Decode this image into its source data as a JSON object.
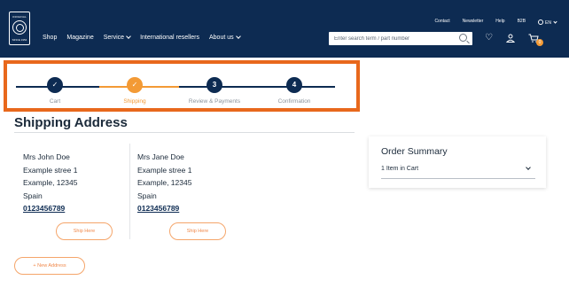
{
  "header": {
    "logo": {
      "brand_text": "ORIGINAL",
      "tag_text": "SINCE 1954"
    },
    "main_nav": [
      {
        "label": "Shop",
        "has_dropdown": false
      },
      {
        "label": "Magazine",
        "has_dropdown": false
      },
      {
        "label": "Service",
        "has_dropdown": true
      },
      {
        "label": "International resellers",
        "has_dropdown": false
      },
      {
        "label": "About us",
        "has_dropdown": true
      }
    ],
    "top_nav": {
      "contact": "Contact",
      "newsletter": "Newsletter",
      "help": "Help",
      "b2b": "B2B",
      "language": "EN"
    },
    "search": {
      "placeholder": "Enter search term / part number",
      "value": ""
    },
    "cart_count": "0"
  },
  "stepper": {
    "steps": [
      {
        "number": "1",
        "label": "Cart",
        "state": "done"
      },
      {
        "number": "2",
        "label": "Shipping",
        "state": "current"
      },
      {
        "number": "3",
        "label": "Review & Payments",
        "state": "todo"
      },
      {
        "number": "4",
        "label": "Confirmation",
        "state": "todo"
      }
    ],
    "colors": {
      "done": "#0d2b52",
      "current": "#f39a35",
      "todo": "#0d2b52",
      "label_current": "#f39a35",
      "label_default": "#8a939c"
    }
  },
  "shipping": {
    "title": "Shipping Address",
    "addresses": [
      {
        "name": "Mrs John Doe",
        "street": "Example stree 1",
        "city": "Example, 12345",
        "country": "Spain",
        "phone": "0123456789",
        "button": "Ship Here"
      },
      {
        "name": "Mrs Jane Doe",
        "street": "Example stree 1",
        "city": "Example, 12345",
        "country": "Spain",
        "phone": "0123456789",
        "button": "Ship Here"
      }
    ],
    "new_address_button": "+ New Address"
  },
  "order_summary": {
    "title": "Order Summary",
    "items_text": "1 Item in Cart"
  },
  "colors": {
    "header_bg": "#0d2b52",
    "accent": "#f39a35",
    "highlight_frame": "#e8681c"
  },
  "icons": {
    "heart": "heart-icon",
    "user": "user-icon",
    "cart": "cart-icon",
    "search": "search-icon",
    "globe": "globe-icon",
    "check": "check-icon"
  }
}
